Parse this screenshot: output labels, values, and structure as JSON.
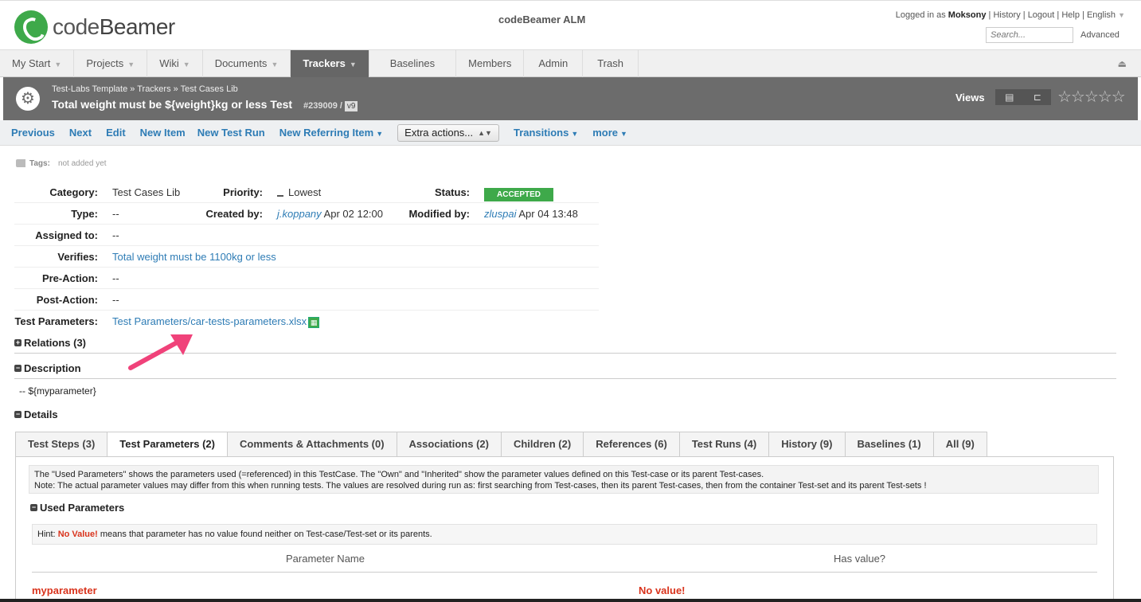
{
  "header": {
    "logo_text_light": "code",
    "logo_text_bold": "Beamer",
    "app_title": "codeBeamer ALM",
    "logged_in_prefix": "Logged in as",
    "username": "Moksony",
    "links": [
      "History",
      "Logout",
      "Help",
      "English"
    ],
    "search_placeholder": "Search...",
    "advanced_label": "Advanced"
  },
  "nav": {
    "items": [
      {
        "label": "My Start",
        "caret": true
      },
      {
        "label": "Projects",
        "caret": true
      },
      {
        "label": "Wiki",
        "caret": true
      },
      {
        "label": "Documents",
        "caret": true
      },
      {
        "label": "Trackers",
        "caret": true,
        "active": true
      },
      {
        "label": "Baselines",
        "caret": false
      },
      {
        "label": "Members",
        "caret": false
      },
      {
        "label": "Admin",
        "caret": false
      },
      {
        "label": "Trash",
        "caret": false
      }
    ]
  },
  "titlebar": {
    "breadcrumb": [
      "Test-Labs Template",
      "Trackers",
      "Test Cases Lib"
    ],
    "title": "Total weight must be ${weight}kg or less Test",
    "item_id": "#239009 /",
    "version": "v9",
    "views_label": "Views",
    "stars": "☆☆☆☆☆"
  },
  "actions": {
    "previous": "Previous",
    "next": "Next",
    "edit": "Edit",
    "new_item": "New Item",
    "new_test_run": "New Test Run",
    "new_referring_item": "New Referring Item",
    "extra_actions": "Extra actions...",
    "transitions": "Transitions",
    "more": "more"
  },
  "tags": {
    "label": "Tags:",
    "value": "not added yet"
  },
  "properties": {
    "category_label": "Category:",
    "category_value": "Test Cases Lib",
    "priority_label": "Priority:",
    "priority_value": "Lowest",
    "status_label": "Status:",
    "status_value": "ACCEPTED",
    "type_label": "Type:",
    "type_value": "--",
    "created_by_label": "Created by:",
    "created_by_user": "j.koppany",
    "created_by_date": "Apr 02 12:00",
    "modified_by_label": "Modified by:",
    "modified_by_user": "zluspai",
    "modified_by_date": "Apr 04 13:48",
    "assigned_label": "Assigned to:",
    "assigned_value": "--",
    "verifies_label": "Verifies:",
    "verifies_value": "Total weight must be 1100kg or less",
    "pre_action_label": "Pre-Action:",
    "pre_action_value": "--",
    "post_action_label": "Post-Action:",
    "post_action_value": "--",
    "test_params_label": "Test Parameters:",
    "test_params_value": "Test Parameters/car-tests-parameters.xlsx"
  },
  "sections": {
    "relations": "Relations (3)",
    "description": "Description",
    "description_text": "-- ${myparameter}",
    "details": "Details"
  },
  "tabs": [
    {
      "label": "Test Steps (3)"
    },
    {
      "label": "Test Parameters (2)",
      "active": true
    },
    {
      "label": "Comments & Attachments (0)"
    },
    {
      "label": "Associations (2)"
    },
    {
      "label": "Children (2)"
    },
    {
      "label": "References (6)"
    },
    {
      "label": "Test Runs (4)"
    },
    {
      "label": "History (9)"
    },
    {
      "label": "Baselines (1)"
    },
    {
      "label": "All (9)"
    }
  ],
  "test_params_panel": {
    "info_line1": "The \"Used Parameters\" shows the parameters used (=referenced) in this TestCase. The \"Own\" and \"Inherited\" show the parameter values defined on this Test-case or its parent Test-cases.",
    "info_line2": "Note: The actual parameter values may differ from this when running tests. The values are resolved during run as: first searching from Test-cases, then its parent Test-cases, then from the container Test-set and its parent Test-sets !",
    "used_parameters_heading": "Used Parameters",
    "hint_prefix": "Hint:",
    "hint_no_value": "No Value!",
    "hint_suffix": "means that parameter has no value found neither on Test-case/Test-set or its parents.",
    "col_param_name": "Parameter Name",
    "col_has_value": "Has value?",
    "rows": [
      {
        "name": "myparameter",
        "value": "No value!"
      }
    ]
  },
  "colors": {
    "accent_blue": "#2e7cb5",
    "status_green": "#3ea94a",
    "titlebar_gray": "#6c6c6c",
    "error_red": "#d9331c",
    "annotation_pink": "#f0427a"
  }
}
